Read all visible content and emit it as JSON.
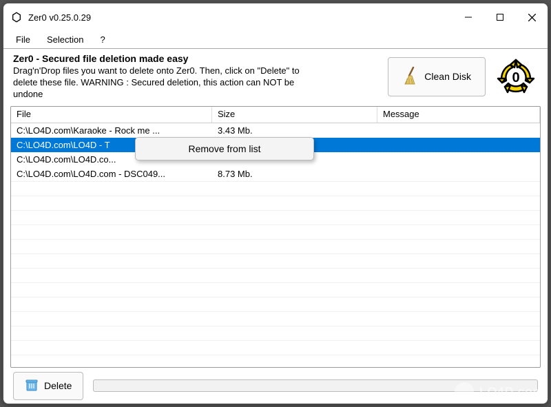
{
  "window": {
    "title": "Zer0 v0.25.0.29"
  },
  "menubar": {
    "items": [
      {
        "label": "File"
      },
      {
        "label": "Selection"
      },
      {
        "label": "?"
      }
    ]
  },
  "header": {
    "title": "Zer0 - Secured file deletion made easy",
    "description": "Drag'n'Drop files you want to delete onto Zer0. Then, click on \"Delete\" to delete these file. WARNING : Secured deletion, this action can NOT be undone",
    "clean_button": "Clean Disk",
    "logo_center": "0"
  },
  "columns": {
    "file": "File",
    "size": "Size",
    "message": "Message"
  },
  "rows": [
    {
      "file": "C:\\LO4D.com\\Karaoke - Rock me ...",
      "size": "3.43 Mb.",
      "message": "",
      "selected": false
    },
    {
      "file": "C:\\LO4D.com\\LO4D - T",
      "size": "",
      "message": "",
      "selected": true
    },
    {
      "file": "C:\\LO4D.com\\LO4D.co...",
      "size": "",
      "message": "",
      "selected": false
    },
    {
      "file": "C:\\LO4D.com\\LO4D.com - DSC049...",
      "size": "8.73 Mb.",
      "message": "",
      "selected": false
    }
  ],
  "contextmenu": {
    "items": [
      {
        "label": "Remove from list"
      }
    ]
  },
  "footer": {
    "delete_button": "Delete",
    "progress_value": 0
  },
  "watermark": "LO4D.com",
  "colors": {
    "selection": "#0078d7"
  }
}
